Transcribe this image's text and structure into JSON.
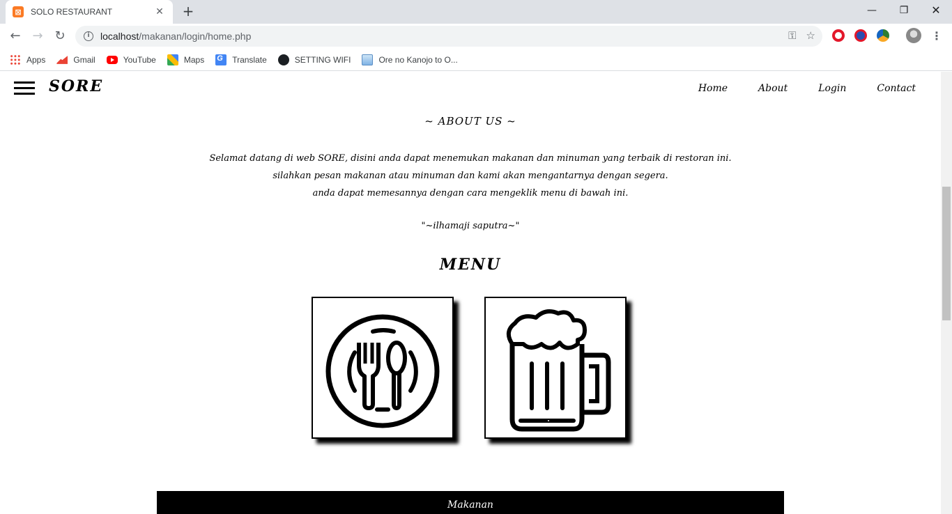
{
  "browser": {
    "tab_title": "SOLO RESTAURANT",
    "tab_close": "✕",
    "new_tab": "+",
    "url_host": "localhost",
    "url_path": "/makanan/login/home.php",
    "bookmarks": [
      {
        "label": "Apps",
        "icon": "apps-icon"
      },
      {
        "label": "Gmail",
        "icon": "gmail-icon"
      },
      {
        "label": "YouTube",
        "icon": "youtube-icon"
      },
      {
        "label": "Maps",
        "icon": "maps-icon"
      },
      {
        "label": "Translate",
        "icon": "translate-icon"
      },
      {
        "label": "SETTING WIFI",
        "icon": "github-icon"
      },
      {
        "label": "Ore no Kanojo to O...",
        "icon": "bookmark-page-icon"
      }
    ]
  },
  "site": {
    "logo": "SORE",
    "nav": [
      "Home",
      "About",
      "Login",
      "Contact"
    ],
    "about_title": "~ ABOUT US ~",
    "about_lines": [
      "Selamat datang di web SORE, disini anda dapat menemukan makanan dan minuman yang terbaik di restoran ini.",
      "silahkan pesan makanan atau minuman dan kami akan mengantarnya dengan segera.",
      "anda dapat memesannya dengan cara mengeklik menu di bawah ini."
    ],
    "quote": "\"~ilhamaji saputra~\"",
    "menu_title": "MENU",
    "menu_items": [
      {
        "name": "food",
        "icon": "plate-fork-spoon-icon"
      },
      {
        "name": "drink",
        "icon": "beer-mug-icon"
      }
    ],
    "section_label": "Makanan"
  },
  "colors": {
    "accent": "#000000",
    "tab_bar": "#dee1e6",
    "favicon": "#fb7a24"
  }
}
